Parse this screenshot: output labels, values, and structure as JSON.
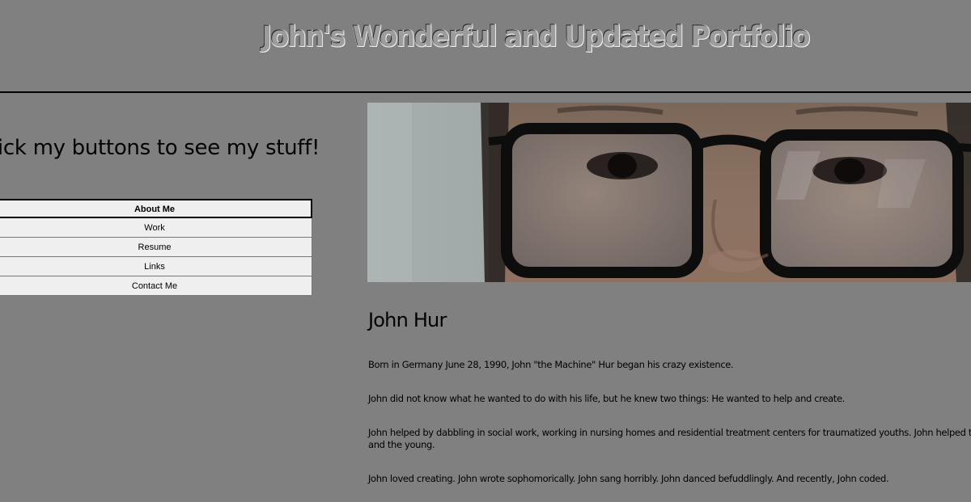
{
  "header": {
    "title": "John's Wonderful and Updated Portfolio"
  },
  "sidebar": {
    "tagline": "lick my buttons to see my stuff!",
    "buttons": [
      {
        "label": "About Me",
        "active": true
      },
      {
        "label": "Work",
        "active": false
      },
      {
        "label": "Resume",
        "active": false
      },
      {
        "label": "Links",
        "active": false
      },
      {
        "label": "Contact Me",
        "active": false
      }
    ]
  },
  "main": {
    "name": "John Hur",
    "paragraphs": [
      "Born in Germany June 28, 1990, John \"the Machine\" Hur began his crazy existence.",
      "John did not know what he wanted to do with his life, but he knew two things: He wanted to help and create.",
      "John helped by dabbling in social work, working in nursing homes and residential treatment centers for traumatized youths. John helped the old and the young.",
      "John loved creating. John wrote sophomorically. John sang horribly. John danced befuddlingly. And recently, John coded."
    ]
  },
  "colors": {
    "background": "#808080",
    "button_bg": "#efefef",
    "text": "#000000"
  }
}
